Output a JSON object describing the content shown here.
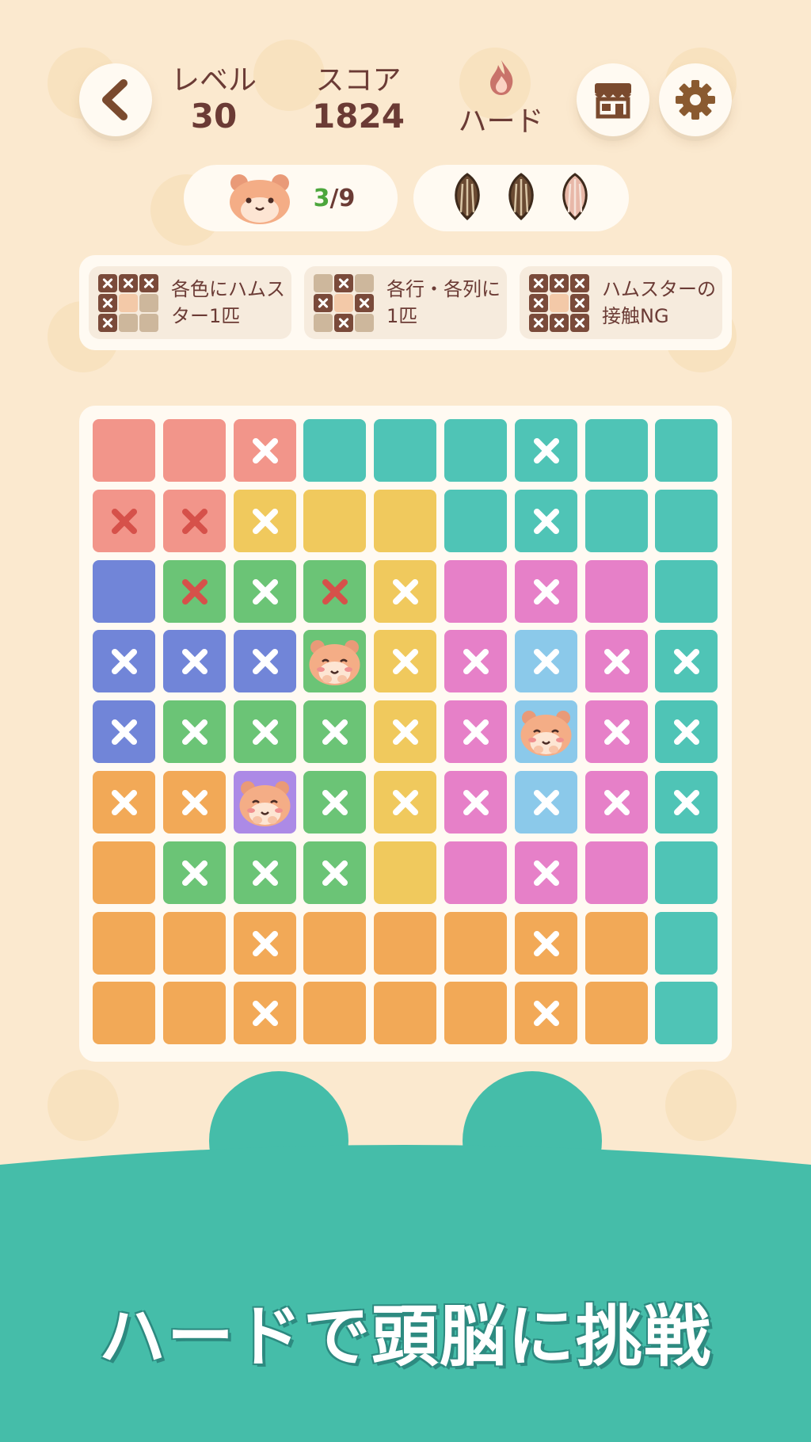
{
  "header": {
    "level_label": "レベル",
    "level_value": "30",
    "score_label": "スコア",
    "score_value": "1824",
    "difficulty": "ハード",
    "difficulty_icon": "fire-icon",
    "back_icon": "chevron-left-icon",
    "shop_icon": "shop-icon",
    "settings_icon": "gear-icon"
  },
  "progress": {
    "found": "3",
    "separator_total": "/9",
    "hamster_icon": "hamster-icon",
    "seeds_total": 3,
    "seeds_remaining": 2
  },
  "rules": [
    {
      "text": "各色にハムスター1匹",
      "minimap": [
        "x",
        "x",
        "x",
        "x",
        "h",
        "",
        "x",
        "",
        ""
      ]
    },
    {
      "text": "各行・各列に1匹",
      "minimap": [
        "",
        "x",
        "",
        "x",
        "h",
        "x",
        "",
        "x",
        ""
      ]
    },
    {
      "text": "ハムスターの接触NG",
      "minimap": [
        "x",
        "x",
        "x",
        "x",
        "h",
        "x",
        "x",
        "x",
        "x"
      ]
    }
  ],
  "colors": {
    "R": "#f2958a",
    "T": "#4fc4b6",
    "Y": "#f0c95d",
    "B": "#7185d8",
    "G": "#6bc476",
    "P": "#e680c8",
    "L": "#8bc9ea",
    "O": "#f2a957",
    "V": "#ac8ae6"
  },
  "board": {
    "rows": [
      [
        "R",
        "R",
        "R",
        "T",
        "T",
        "T",
        "T",
        "T",
        "T"
      ],
      [
        "R",
        "R",
        "Y",
        "Y",
        "Y",
        "T",
        "T",
        "T",
        "T"
      ],
      [
        "B",
        "G",
        "G",
        "G",
        "Y",
        "P",
        "P",
        "P",
        "T"
      ],
      [
        "B",
        "B",
        "B",
        "G",
        "Y",
        "P",
        "L",
        "P",
        "T"
      ],
      [
        "B",
        "G",
        "G",
        "G",
        "Y",
        "P",
        "L",
        "P",
        "T"
      ],
      [
        "O",
        "O",
        "V",
        "G",
        "Y",
        "P",
        "L",
        "P",
        "T"
      ],
      [
        "O",
        "G",
        "G",
        "G",
        "Y",
        "P",
        "P",
        "P",
        "T"
      ],
      [
        "O",
        "O",
        "O",
        "O",
        "O",
        "O",
        "O",
        "O",
        "T"
      ],
      [
        "O",
        "O",
        "O",
        "O",
        "O",
        "O",
        "O",
        "O",
        "T"
      ]
    ],
    "marks": [
      [
        "",
        "",
        "x",
        "",
        "",
        "",
        "x",
        "",
        ""
      ],
      [
        "r",
        "r",
        "x",
        "",
        "",
        "",
        "x",
        "",
        ""
      ],
      [
        "",
        "r",
        "x",
        "r",
        "x",
        "",
        "x",
        "",
        ""
      ],
      [
        "x",
        "x",
        "x",
        "h",
        "x",
        "x",
        "x",
        "x",
        "x"
      ],
      [
        "x",
        "x",
        "x",
        "x",
        "x",
        "x",
        "h",
        "x",
        "x"
      ],
      [
        "x",
        "x",
        "h",
        "x",
        "x",
        "x",
        "x",
        "x",
        "x"
      ],
      [
        "",
        "x",
        "x",
        "x",
        "",
        "",
        "x",
        "",
        ""
      ],
      [
        "",
        "",
        "x",
        "",
        "",
        "",
        "x",
        "",
        ""
      ],
      [
        "",
        "",
        "x",
        "",
        "",
        "",
        "x",
        "",
        ""
      ]
    ]
  },
  "caption": "ハードで頭脳に挑戦"
}
